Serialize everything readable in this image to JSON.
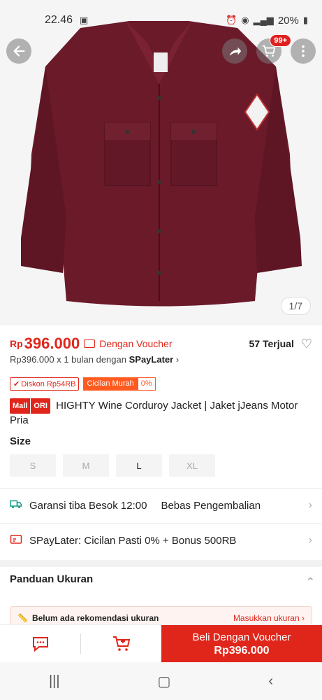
{
  "status": {
    "time": "22.46",
    "battery": "20%"
  },
  "hero": {
    "counter": "1/7",
    "cart_badge": "99+"
  },
  "price": {
    "currency": "Rp",
    "amount": "396.000",
    "voucher_label": "Dengan Voucher",
    "sold": "57 Terjual",
    "paylater_prefix": "Rp396.000 x 1 bulan dengan",
    "paylater_brand": "SPayLater",
    "paylater_suffix": "›"
  },
  "chips": {
    "discount": "Diskon Rp54RB",
    "cicilan": "Cicilan Murah",
    "cicilan_rate": "0%"
  },
  "product": {
    "mall_a": "Mall",
    "mall_b": "ORI",
    "title": "HIGHTY Wine Corduroy Jacket | Jaket jJeans Motor Pria"
  },
  "size": {
    "label": "Size",
    "options": [
      "S",
      "M",
      "L",
      "XL"
    ]
  },
  "info": {
    "shipping": "Garansi tiba Besok 12:00",
    "returns": "Bebas Pengembalian",
    "paylater": "SPayLater: Cicilan Pasti 0% + Bonus 500RB"
  },
  "panduan": {
    "title": "Panduan Ukuran"
  },
  "reko": {
    "left": "Belum ada rekomendasi ukuran",
    "right": "Masukkan ukuran"
  },
  "buy": {
    "line1": "Beli Dengan Voucher",
    "line2": "Rp396.000"
  },
  "colors": {
    "accent": "#e0261b",
    "jacket": "#6b1a2a"
  }
}
